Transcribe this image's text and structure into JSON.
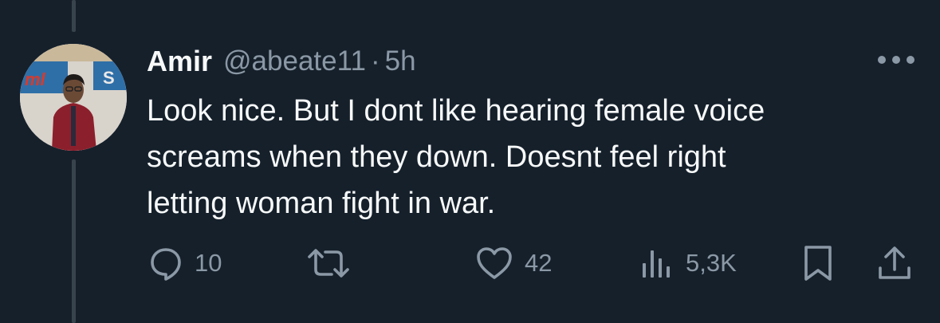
{
  "tweet": {
    "author": {
      "display_name": "Amir",
      "handle": "@abeate11",
      "separator": "·",
      "time": "5h"
    },
    "text": "Look nice. But I dont like hearing female voice\nscreams when they down. Doesnt feel right\nletting woman fight in war.",
    "actions": {
      "replies": "10",
      "likes": "42",
      "views": "5,3K"
    }
  },
  "icons": {
    "more": "more-horizontal-icon",
    "reply": "reply-bubble-icon",
    "retweet": "retweet-icon",
    "like": "heart-icon",
    "views": "analytics-bars-icon",
    "bookmark": "bookmark-icon",
    "share": "share-upload-icon"
  },
  "colors": {
    "background": "#15202b",
    "primary_text": "#f7f9f9",
    "secondary_text": "#8b98a5",
    "thread_line": "#38444d"
  }
}
